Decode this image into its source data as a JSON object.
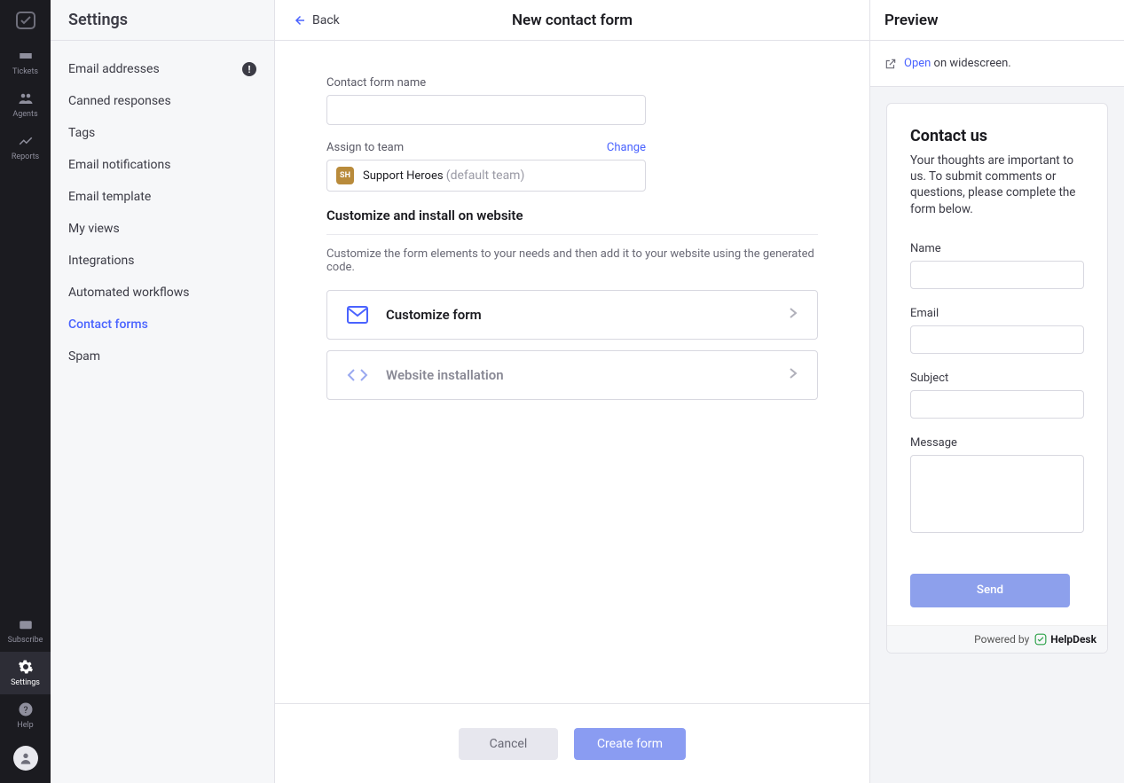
{
  "leftrail": {
    "items": [
      "Tickets",
      "Agents",
      "Reports"
    ],
    "bottom": {
      "subscribe": "Subscribe",
      "settings": "Settings",
      "help": "Help"
    }
  },
  "sidebar": {
    "title": "Settings",
    "items": [
      {
        "label": "Email addresses",
        "badge": "!"
      },
      {
        "label": "Canned responses"
      },
      {
        "label": "Tags"
      },
      {
        "label": "Email notifications"
      },
      {
        "label": "Email template"
      },
      {
        "label": "My views"
      },
      {
        "label": "Integrations"
      },
      {
        "label": "Automated workflows"
      },
      {
        "label": "Contact forms",
        "active": true
      },
      {
        "label": "Spam"
      }
    ]
  },
  "main": {
    "back": "Back",
    "title": "New contact form",
    "name_label": "Contact form name",
    "assign_label": "Assign to team",
    "change": "Change",
    "team_pill": "SH",
    "team_name": "Support Heroes ",
    "team_default": "(default team)",
    "customize_title": "Customize and install on website",
    "customize_desc": "Customize the form elements to your needs and then add it to your website using the generated code.",
    "card_customize": "Customize form",
    "card_install": "Website installation",
    "cancel": "Cancel",
    "create": "Create form"
  },
  "preview": {
    "title": "Preview",
    "open_link": "Open",
    "open_rest": " on widescreen.",
    "card_title": "Contact us",
    "card_desc": "Your thoughts are important to us. To submit comments or questions, please complete the form below.",
    "fields": {
      "name": "Name",
      "email": "Email",
      "subject": "Subject",
      "message": "Message"
    },
    "send": "Send",
    "powered": "Powered by",
    "brand": "HelpDesk"
  }
}
